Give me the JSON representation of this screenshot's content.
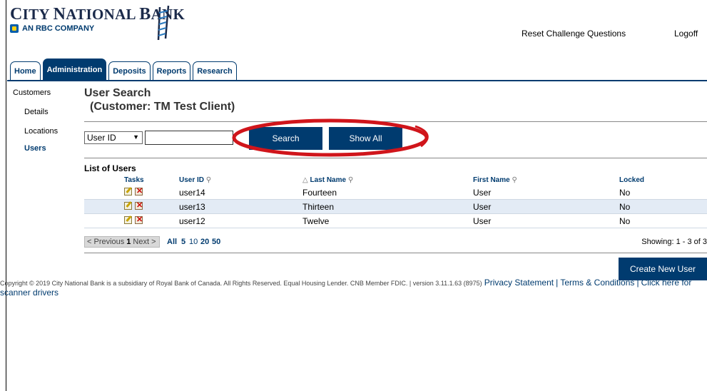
{
  "brand": {
    "name_first": "C",
    "name_rest": "ITY ",
    "name_first2": "N",
    "name_rest2": "ATIONAL ",
    "name_first3": "B",
    "name_rest3": "ANK",
    "subtitle": "AN RBC COMPANY"
  },
  "header_links": {
    "reset": "Reset Challenge Questions",
    "logoff": "Logoff"
  },
  "tabs": [
    {
      "label": "Home"
    },
    {
      "label": "Administration"
    },
    {
      "label": "Deposits"
    },
    {
      "label": "Reports"
    },
    {
      "label": "Research"
    }
  ],
  "side_nav": {
    "customers": "Customers",
    "details": "Details",
    "locations": "Locations",
    "users": "Users"
  },
  "page": {
    "title": "User Search",
    "subtitle": "(Customer: TM Test Client)"
  },
  "search": {
    "field_selected": "User ID",
    "input_value": "",
    "search_label": "Search",
    "show_all_label": "Show All"
  },
  "list": {
    "title": "List of Users",
    "columns": {
      "tasks": "Tasks",
      "user_id": "User ID",
      "last_name": "Last Name",
      "first_name": "First Name",
      "locked": "Locked"
    },
    "sort_indicator": "△",
    "rows": [
      {
        "user_id": "user14",
        "last_name": "Fourteen",
        "first_name": "User",
        "locked": "No"
      },
      {
        "user_id": "user13",
        "last_name": "Thirteen",
        "first_name": "User",
        "locked": "No"
      },
      {
        "user_id": "user12",
        "last_name": "Twelve",
        "first_name": "User",
        "locked": "No"
      }
    ]
  },
  "pager": {
    "previous": "< Previous",
    "current": "1",
    "next": "Next >",
    "all": "All",
    "sizes": [
      "5",
      "10",
      "20",
      "50"
    ],
    "showing": "Showing: 1 - 3 of 3"
  },
  "create_button": "Create New User",
  "footer": {
    "copyright": "Copyright © 2019 City National Bank is a subsidiary of Royal Bank of Canada. All Rights Reserved. Equal Housing Lender. CNB Member FDIC. | version 3.11.1.63 (8975)",
    "privacy": "Privacy Statement",
    "sep": "|",
    "terms": "Terms & Conditions",
    "click": "Click here for scanner drivers"
  },
  "colors": {
    "brand_navy": "#003b6f",
    "row_alt": "#e3ebf5",
    "highlight_red": "#d0151b"
  }
}
